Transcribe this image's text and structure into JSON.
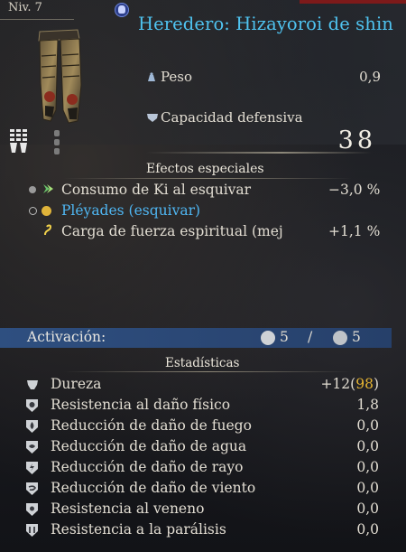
{
  "header": {
    "level": "Niv. 7",
    "item_title": "Heredero: Hizayoroi de shin"
  },
  "base_stats": [
    {
      "icon": "weight-icon",
      "label": "Peso",
      "value": "0,9"
    },
    {
      "icon": "defense-icon",
      "label": "Capacidad defensiva",
      "value": "38"
    }
  ],
  "special_effects": {
    "title": "Efectos especiales",
    "items": [
      {
        "icon": "ki-arrow-icon",
        "label": "Consumo de Ki al esquivar",
        "value": "−3,0 %",
        "color": "#e2ddd2"
      },
      {
        "icon": "set-icon",
        "label": "Pléyades (esquivar)",
        "value": "",
        "color": "#4fb6f2"
      },
      {
        "icon": "spirit-icon",
        "label": "Carga de fuerza espiritual (mej",
        "value": "+1,1 %",
        "color": "#e2ddd2"
      }
    ]
  },
  "activation": {
    "label": "Activación:",
    "value_left": "5",
    "separator": "/",
    "value_right": "5"
  },
  "stats": {
    "title": "Estadísticas",
    "toughness": {
      "label": "Dureza",
      "value": "+12(",
      "value_highlight": "98",
      "value_end": ")"
    },
    "rows": [
      {
        "label": "Resistencia al daño físico",
        "value": "1,8"
      },
      {
        "label": "Reducción de daño de fuego",
        "value": "0,0"
      },
      {
        "label": "Reducción de daño de agua",
        "value": "0,0"
      },
      {
        "label": "Reducción de daño de rayo",
        "value": "0,0"
      },
      {
        "label": "Reducción de daño de viento",
        "value": "0,0"
      },
      {
        "label": "Resistencia al veneno",
        "value": "0,0"
      },
      {
        "label": "Resistencia a la parálisis",
        "value": "0,0"
      }
    ]
  },
  "colors": {
    "title_blue": "#4fc3f0",
    "activation_bar": "#2e4f80",
    "highlight_gold": "#e7b532",
    "set_blue": "#4fb6f2"
  }
}
